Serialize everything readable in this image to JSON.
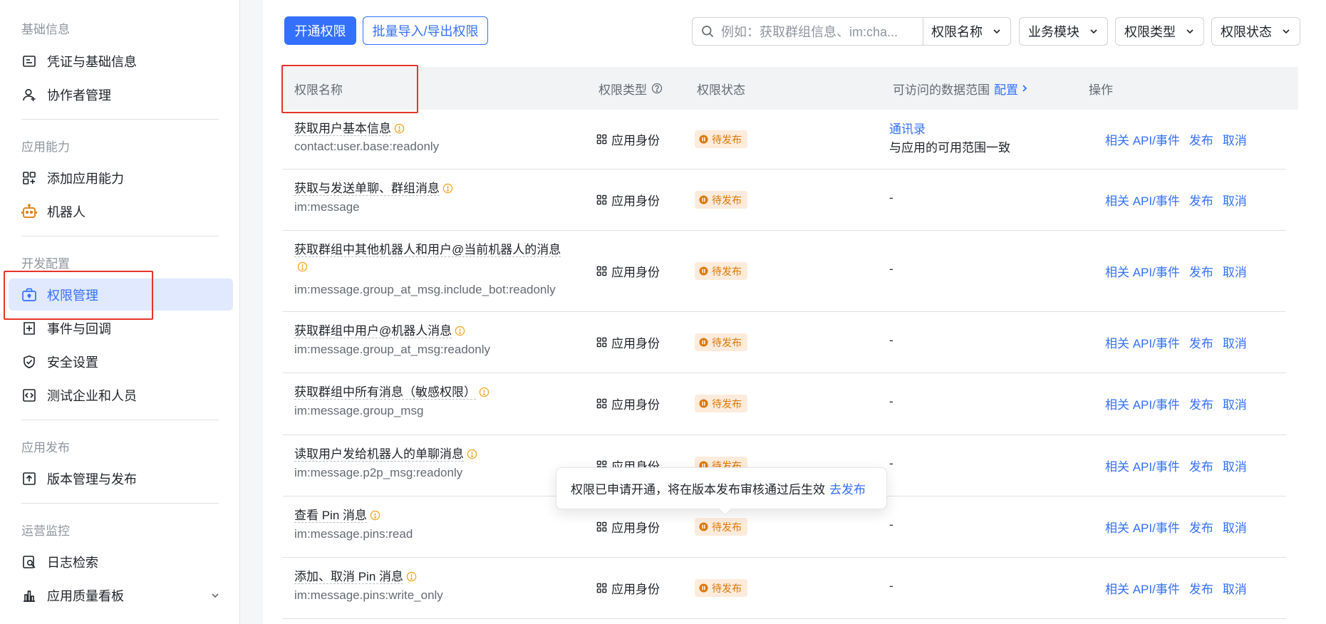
{
  "sidebar": {
    "groups": [
      "基础信息",
      "应用能力",
      "开发配置",
      "应用发布",
      "运营监控"
    ],
    "items": [
      {
        "label": "凭证与基础信息",
        "icon": "id-card-icon"
      },
      {
        "label": "协作者管理",
        "icon": "user-add-icon"
      },
      {
        "label": "添加应用能力",
        "icon": "apps-add-icon"
      },
      {
        "label": "机器人",
        "icon": "robot-icon"
      },
      {
        "label": "权限管理",
        "icon": "briefcase-lock-icon"
      },
      {
        "label": "事件与回调",
        "icon": "event-plus-icon"
      },
      {
        "label": "安全设置",
        "icon": "shield-check-icon"
      },
      {
        "label": "测试企业和人员",
        "icon": "code-box-icon"
      },
      {
        "label": "版本管理与发布",
        "icon": "upload-box-icon"
      },
      {
        "label": "日志检索",
        "icon": "log-search-icon"
      },
      {
        "label": "应用质量看板",
        "icon": "bar-chart-icon"
      }
    ],
    "active_index": 4
  },
  "toolbar": {
    "enable_label": "开通权限",
    "batch_label": "批量导入/导出权限",
    "search_placeholder": "例如：获取群组信息、im:cha...",
    "filters": [
      "权限名称",
      "业务模块",
      "权限类型",
      "权限状态"
    ]
  },
  "table": {
    "headers": {
      "name": "权限名称",
      "type": "权限类型",
      "status": "权限状态",
      "scope": "可访问的数据范围",
      "config": "配置",
      "ops": "操作"
    },
    "rows": [
      {
        "title": "获取用户基本信息",
        "scope": "contact:user.base:readonly",
        "type": "应用身份",
        "status": "待发布",
        "data_range_link": "通讯录",
        "data_range_text": "与应用的可用范围一致"
      },
      {
        "title": "获取与发送单聊、群组消息",
        "scope": "im:message",
        "type": "应用身份",
        "status": "待发布",
        "data_range_text": "-"
      },
      {
        "title": "获取群组中其他机器人和用户@当前机器人的消息",
        "scope": "im:message.group_at_msg.include_bot:readonly",
        "type": "应用身份",
        "status": "待发布",
        "data_range_text": "-"
      },
      {
        "title": "获取群组中用户@机器人消息",
        "scope": "im:message.group_at_msg:readonly",
        "type": "应用身份",
        "status": "待发布",
        "data_range_text": "-"
      },
      {
        "title": "获取群组中所有消息（敏感权限）",
        "scope": "im:message.group_msg",
        "type": "应用身份",
        "status": "待发布",
        "data_range_text": "-"
      },
      {
        "title": "读取用户发给机器人的单聊消息",
        "scope": "im:message.p2p_msg:readonly",
        "type": "应用身份",
        "status": "待发布",
        "data_range_text": "-"
      },
      {
        "title": "查看 Pin 消息",
        "scope": "im:message.pins:read",
        "type": "应用身份",
        "status": "待发布",
        "data_range_text": "-"
      },
      {
        "title": "添加、取消 Pin 消息",
        "scope": "im:message.pins:write_only",
        "type": "应用身份",
        "status": "待发布",
        "data_range_text": "-"
      }
    ],
    "ops": [
      "相关 API/事件",
      "发布",
      "取消"
    ]
  },
  "tooltip": {
    "text": "权限已申请开通，将在版本发布审核通过后生效",
    "link": "去发布"
  },
  "colors": {
    "accent": "#3370ff",
    "pending": "#de7802",
    "highlight": "#e5352a"
  }
}
